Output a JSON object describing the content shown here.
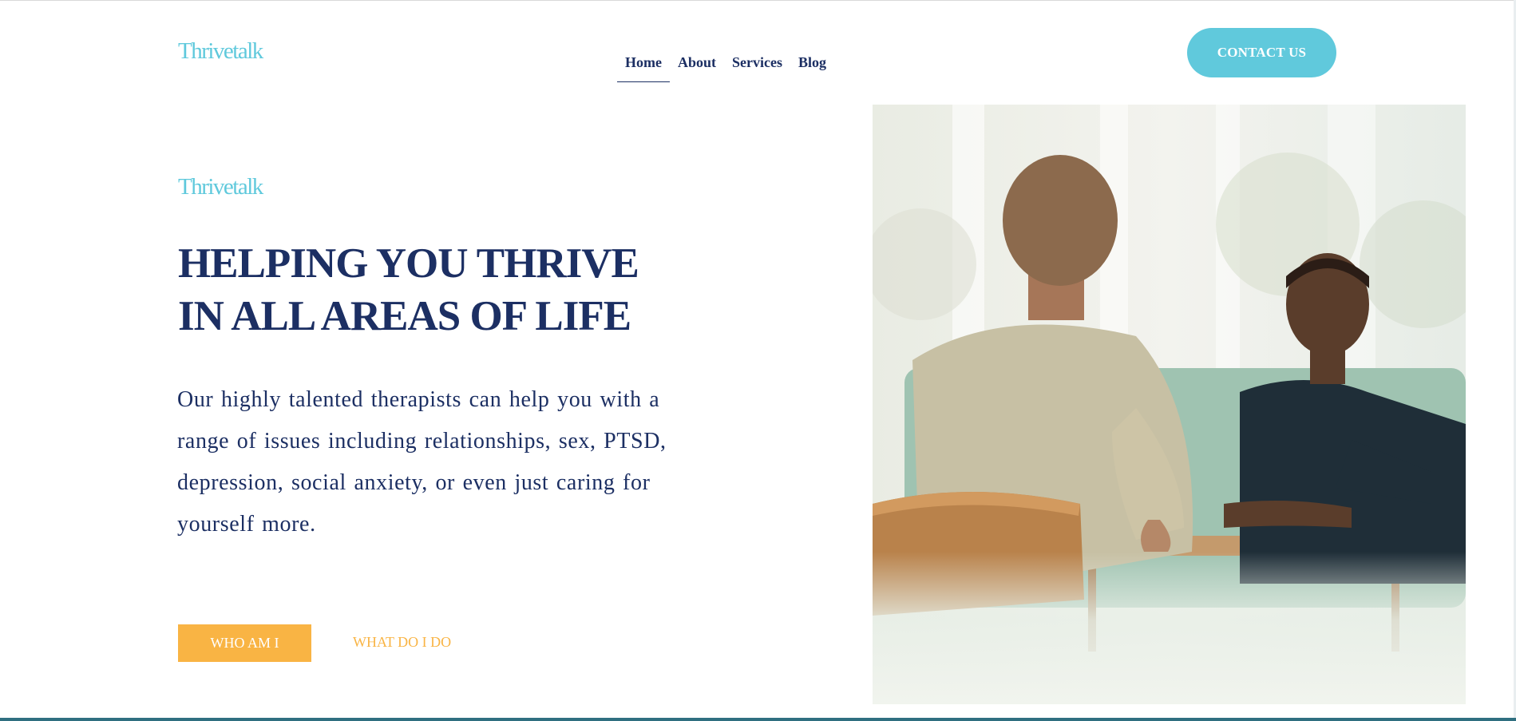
{
  "header": {
    "logo": "Thrivetalk",
    "nav": [
      {
        "label": "Home",
        "active": true
      },
      {
        "label": "About",
        "active": false
      },
      {
        "label": "Services",
        "active": false
      },
      {
        "label": "Blog",
        "active": false
      }
    ],
    "contact_label": "CONTACT US"
  },
  "hero": {
    "brand": "Thrivetalk",
    "title_line1": "HELPING YOU THRIVE",
    "title_line2": "IN ALL AREAS OF LIFE",
    "description": "Our highly talented therapists can help you with a range of issues including relationships, sex, PTSD, depression, social anxiety, or even just caring for yourself more.",
    "primary_button": "WHO AM I",
    "secondary_link": "WHAT DO I DO"
  },
  "colors": {
    "accent_teal": "#5fc9dc",
    "navy": "#1c2f63",
    "orange": "#f9b444"
  },
  "image": {
    "subject": "therapy-session-photo"
  }
}
